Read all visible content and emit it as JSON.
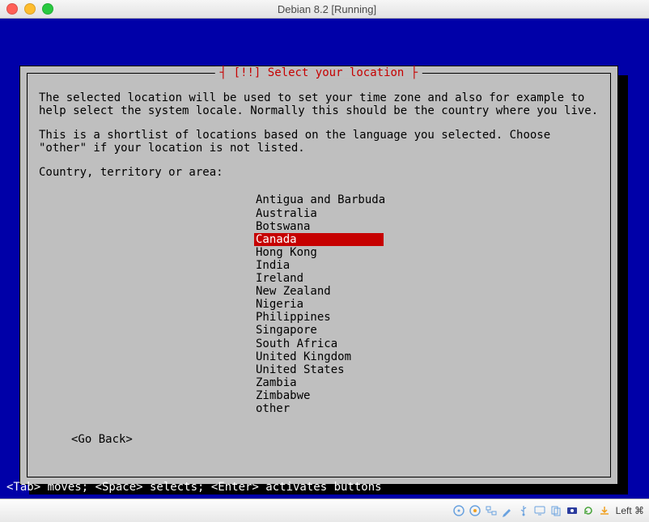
{
  "window": {
    "title": "Debian 8.2 [Running]"
  },
  "dialog": {
    "header": "┤ [!!] Select your location ├",
    "para1": "The selected location will be used to set your time zone and also for example to help select the system locale. Normally this should be the country where you live.",
    "para2": "This is a shortlist of locations based on the language you selected. Choose \"other\" if your location is not listed.",
    "prompt": "Country, territory or area:",
    "go_back": "<Go Back>",
    "selected_index": 3,
    "items": [
      "Antigua and Barbuda",
      "Australia",
      "Botswana",
      "Canada",
      "Hong Kong",
      "India",
      "Ireland",
      "New Zealand",
      "Nigeria",
      "Philippines",
      "Singapore",
      "South Africa",
      "United Kingdom",
      "United States",
      "Zambia",
      "Zimbabwe",
      "other"
    ]
  },
  "hint": "<Tab> moves; <Space> selects; <Enter> activates buttons",
  "status_icons": [
    "optical-disc-icon",
    "disc-indicator-icon",
    "network-icon",
    "pencil-icon",
    "usb-icon",
    "display-icon",
    "clipboard-icon",
    "recorder-icon",
    "refresh-icon",
    "download-icon"
  ],
  "status_text": "Left ⌘"
}
